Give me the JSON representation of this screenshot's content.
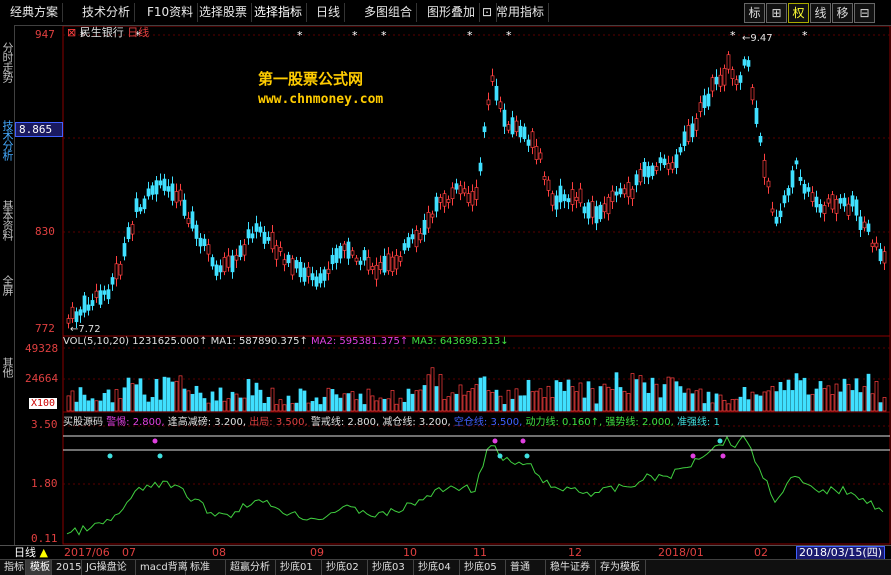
{
  "menubar": {
    "items": [
      "经典方案",
      "技术分析",
      "F10资料",
      "选择股票",
      "选择指标",
      "日线",
      "多图组合",
      "图形叠加",
      "常用指标"
    ],
    "active": "选择指标",
    "right_buttons": [
      "标",
      "⊞",
      "权",
      "线",
      "移",
      "⊟"
    ]
  },
  "left_tabs": [
    "分时走势",
    "技术分析",
    "基本资料",
    "全屏",
    "其他"
  ],
  "stock": {
    "name": "民生银行",
    "period": "日线",
    "watermark_title": "第一股票公式网",
    "watermark_url": "www.chnmoney.com",
    "price_high_label": "947",
    "price_current_label": "8.865",
    "price_mid_label": "830",
    "price_low_label": "772",
    "low_mark": "7.72",
    "high_mark": "9.47"
  },
  "volume": {
    "header_prefix": "VOL(5,10,20)",
    "vol_value": "1231625.000↑",
    "ma1_label": "MA1: 587890.375↑",
    "ma2_label": "MA2: 595381.375↑",
    "ma3_label": "MA3: 643698.313↓",
    "axis_top": "49328",
    "axis_mid": "24664",
    "axis_unit": "X100"
  },
  "indicator": {
    "name": "买股源码",
    "params": [
      {
        "label": "警惕: 2.800,",
        "color": "#e040e0"
      },
      {
        "label": "逢高减磅: 3.200,",
        "color": "#e0e0e0"
      },
      {
        "label": "出局: 3.500,",
        "color": "#e04040"
      },
      {
        "label": "警戒线: 2.800,",
        "color": "#e0e0e0"
      },
      {
        "label": "减仓线: 3.200,",
        "color": "#e0e0e0"
      },
      {
        "label": "空仓线: 3.500,",
        "color": "#4060ff"
      },
      {
        "label": "动力线: 0.160↑,",
        "color": "#40e040"
      },
      {
        "label": "强势线: 2.000,",
        "color": "#40e040"
      },
      {
        "label": "准强线: 1",
        "color": "#40e0e0"
      }
    ],
    "axis_top": "3.50",
    "axis_mid": "1.80",
    "axis_low": "0.11"
  },
  "datebar": {
    "period_label": "日线",
    "start": "2017/06",
    "months": [
      "07",
      "08",
      "09",
      "10",
      "11",
      "12",
      "2018/01",
      "02"
    ],
    "current_date": "2018/03/15(四)"
  },
  "bottom_tabs": [
    "指标",
    "模板",
    "2015",
    "JG操盘论",
    "macd背离",
    "标准",
    "超赢分析",
    "抄底01",
    "抄底02",
    "抄底03",
    "抄底04",
    "抄底05",
    "普通",
    "稳牛证券",
    "存为模板"
  ],
  "bottom_active": "模板",
  "colors": {
    "up": "#ff4040",
    "down": "#40e0ff",
    "accent": "#ffcc00"
  }
}
